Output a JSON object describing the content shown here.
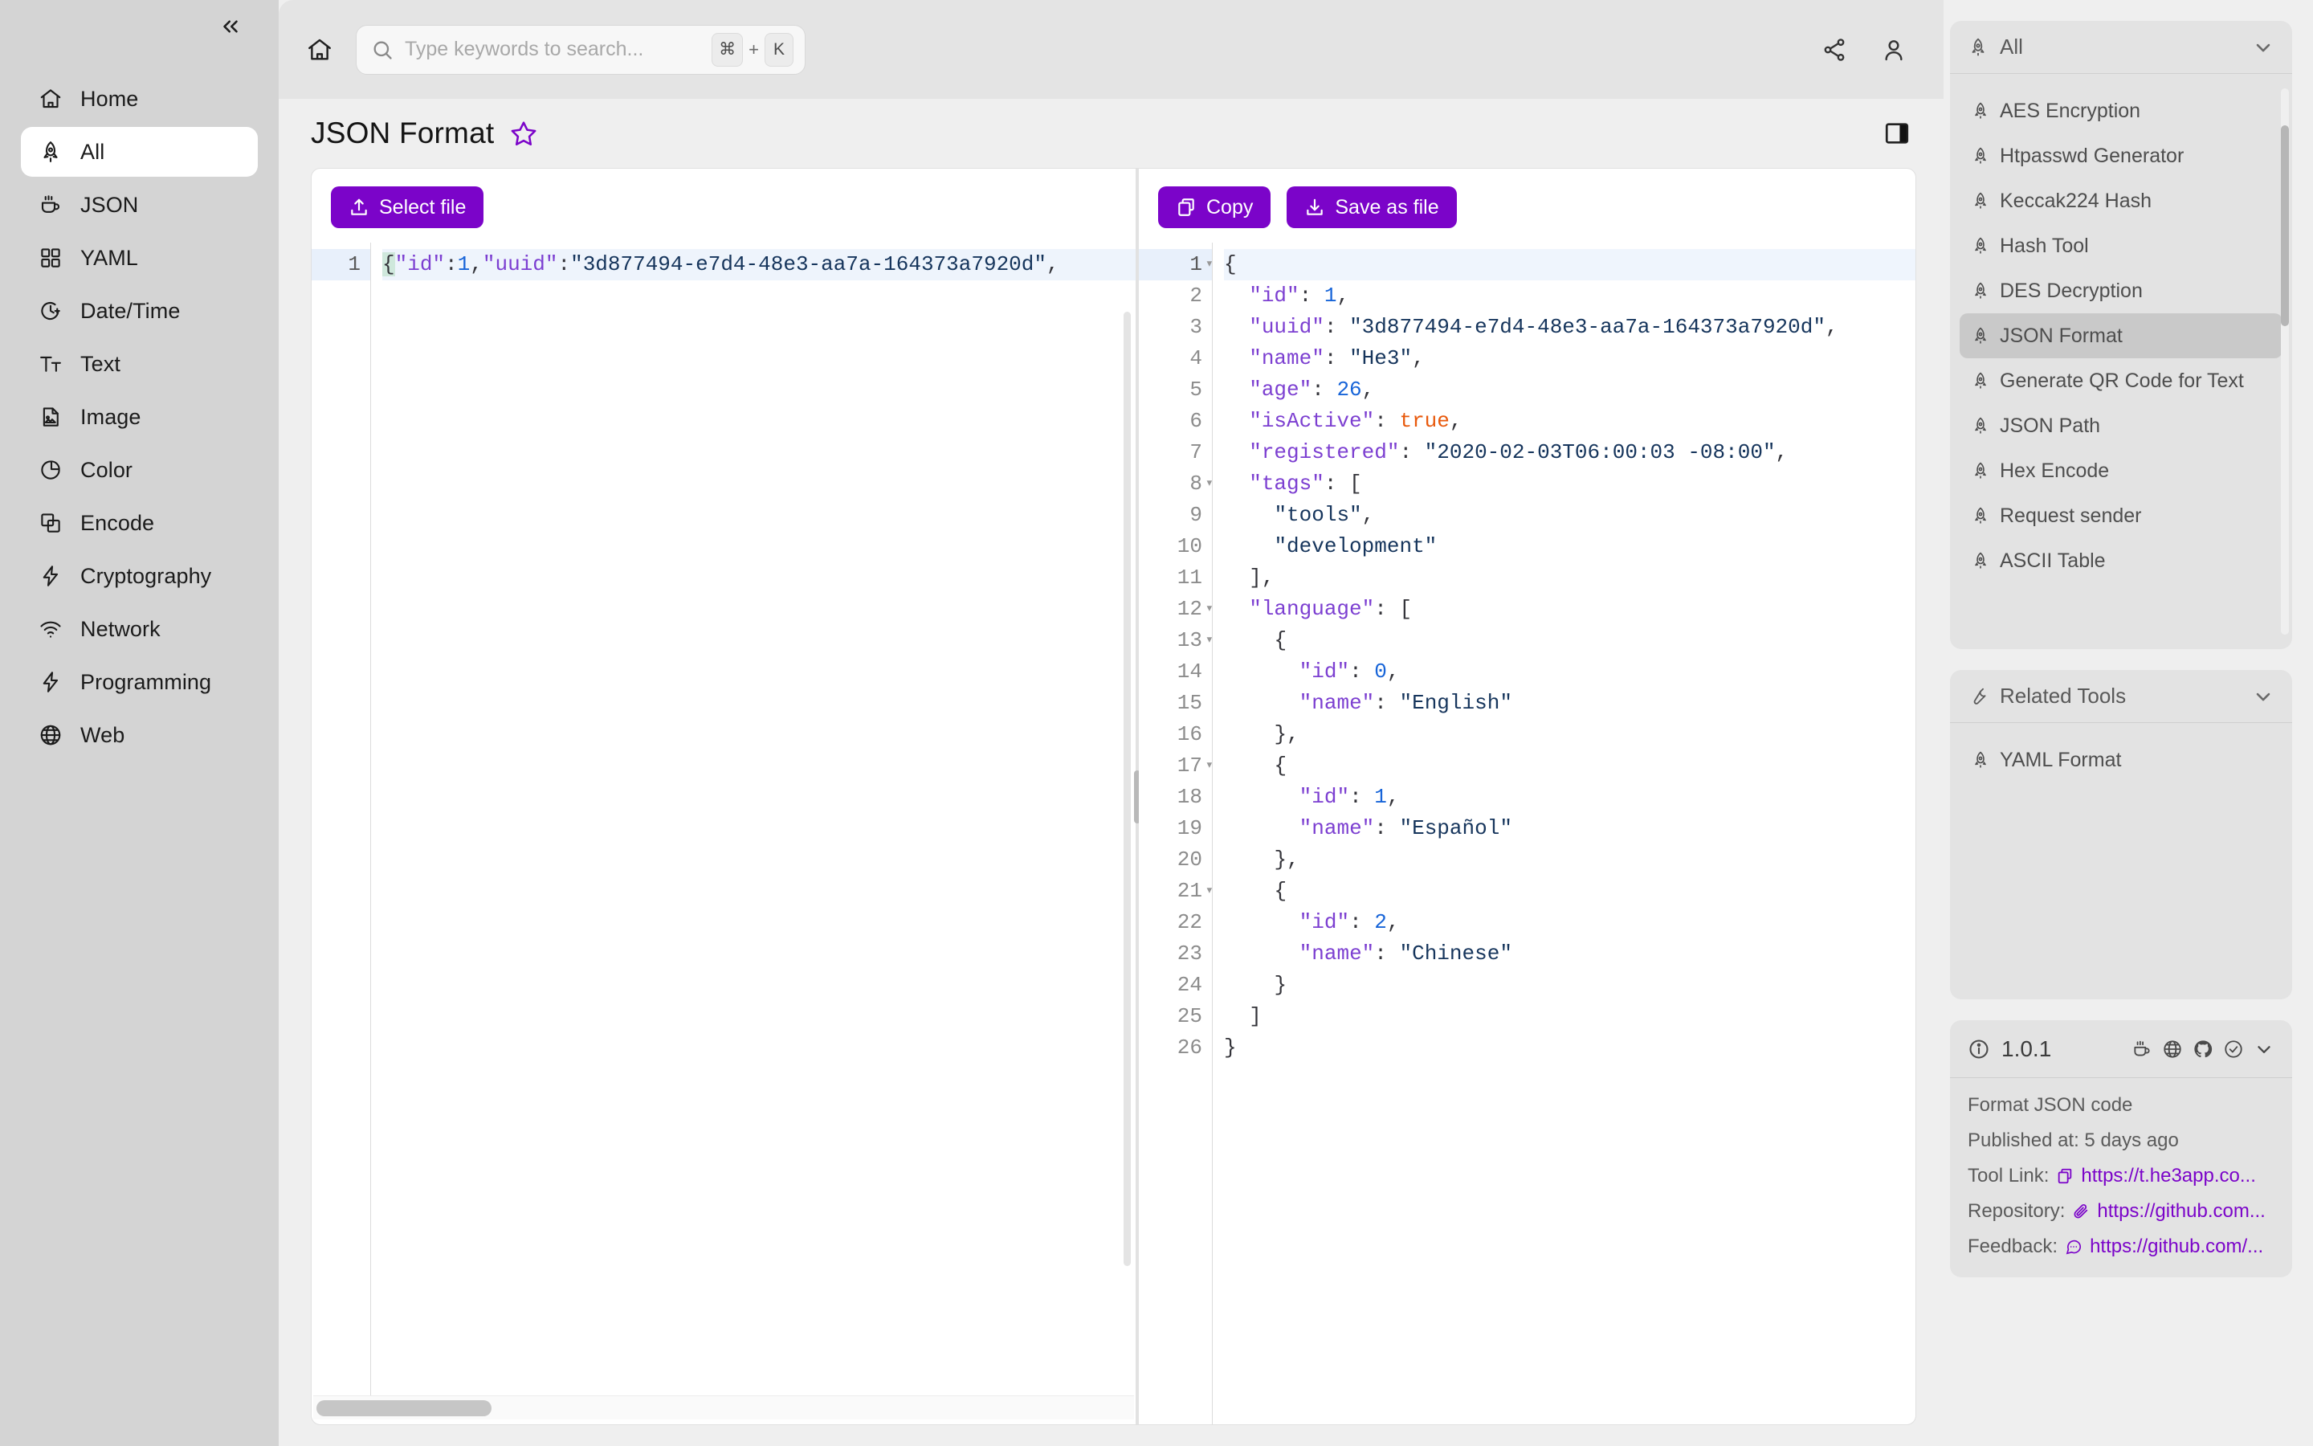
{
  "sidebar": {
    "collapse_icon": "chevrons-left-icon",
    "items": [
      {
        "label": "Home",
        "icon": "home-icon",
        "active": false
      },
      {
        "label": "All",
        "icon": "rocket-icon",
        "active": true
      },
      {
        "label": "JSON",
        "icon": "coffee-cup-icon",
        "active": false
      },
      {
        "label": "YAML",
        "icon": "grid-icon",
        "active": false
      },
      {
        "label": "Date/Time",
        "icon": "clock-icon",
        "active": false
      },
      {
        "label": "Text",
        "icon": "text-size-icon",
        "active": false
      },
      {
        "label": "Image",
        "icon": "image-file-icon",
        "active": false
      },
      {
        "label": "Color",
        "icon": "pie-chart-icon",
        "active": false
      },
      {
        "label": "Encode",
        "icon": "layers-icon",
        "active": false
      },
      {
        "label": "Cryptography",
        "icon": "bolt-icon",
        "active": false
      },
      {
        "label": "Network",
        "icon": "wifi-icon",
        "active": false
      },
      {
        "label": "Programming",
        "icon": "bolt-icon",
        "active": false
      },
      {
        "label": "Web",
        "icon": "globe-icon",
        "active": false
      }
    ]
  },
  "topbar": {
    "home_icon": "home-icon",
    "search": {
      "icon": "search-icon",
      "placeholder": "Type keywords to search...",
      "value": "",
      "shortcut_key_1": "⌘",
      "shortcut_plus": "+",
      "shortcut_key_2": "K"
    },
    "share_icon": "share-icon",
    "account_icon": "user-icon"
  },
  "page": {
    "title": "JSON Format",
    "star_icon": "star-outline-icon",
    "star_color": "#7b04c9",
    "panel_toggle_icon": "right-panel-toggle-icon"
  },
  "input_pane": {
    "select_file_label": "Select file",
    "select_file_icon": "upload-icon",
    "line_numbers": [
      "1"
    ],
    "raw_text": "{\"id\":1,\"uuid\":\"3d877494-e7d4-48e3-aa7a-164373a7920d\","
  },
  "output_pane": {
    "copy_label": "Copy",
    "copy_icon": "copy-icon",
    "save_label": "Save as file",
    "save_icon": "download-icon",
    "lines": [
      {
        "no": "1",
        "fold": true,
        "text": "{"
      },
      {
        "no": "2",
        "fold": false,
        "text": "  \"id\": 1,"
      },
      {
        "no": "3",
        "fold": false,
        "text": "  \"uuid\": \"3d877494-e7d4-48e3-aa7a-164373a7920d\","
      },
      {
        "no": "4",
        "fold": false,
        "text": "  \"name\": \"He3\","
      },
      {
        "no": "5",
        "fold": false,
        "text": "  \"age\": 26,"
      },
      {
        "no": "6",
        "fold": false,
        "text": "  \"isActive\": true,"
      },
      {
        "no": "7",
        "fold": false,
        "text": "  \"registered\": \"2020-02-03T06:00:03 -08:00\","
      },
      {
        "no": "8",
        "fold": true,
        "text": "  \"tags\": ["
      },
      {
        "no": "9",
        "fold": false,
        "text": "    \"tools\","
      },
      {
        "no": "10",
        "fold": false,
        "text": "    \"development\""
      },
      {
        "no": "11",
        "fold": false,
        "text": "  ],"
      },
      {
        "no": "12",
        "fold": true,
        "text": "  \"language\": ["
      },
      {
        "no": "13",
        "fold": true,
        "text": "    {"
      },
      {
        "no": "14",
        "fold": false,
        "text": "      \"id\": 0,"
      },
      {
        "no": "15",
        "fold": false,
        "text": "      \"name\": \"English\""
      },
      {
        "no": "16",
        "fold": false,
        "text": "    },"
      },
      {
        "no": "17",
        "fold": true,
        "text": "    {"
      },
      {
        "no": "18",
        "fold": false,
        "text": "      \"id\": 1,"
      },
      {
        "no": "19",
        "fold": false,
        "text": "      \"name\": \"Español\""
      },
      {
        "no": "20",
        "fold": false,
        "text": "    },"
      },
      {
        "no": "21",
        "fold": true,
        "text": "    {"
      },
      {
        "no": "22",
        "fold": false,
        "text": "      \"id\": 2,"
      },
      {
        "no": "23",
        "fold": false,
        "text": "      \"name\": \"Chinese\""
      },
      {
        "no": "24",
        "fold": false,
        "text": "    }"
      },
      {
        "no": "25",
        "fold": false,
        "text": "  ]"
      },
      {
        "no": "26",
        "fold": false,
        "text": "}"
      }
    ]
  },
  "rightbar": {
    "tools_card": {
      "icon": "rocket-icon",
      "title": "All",
      "chevron_icon": "chevron-down-icon",
      "items": [
        {
          "label": "AES Encryption",
          "active": false
        },
        {
          "label": "Htpasswd Generator",
          "active": false
        },
        {
          "label": "Keccak224 Hash",
          "active": false
        },
        {
          "label": "Hash Tool",
          "active": false
        },
        {
          "label": "DES Decryption",
          "active": false
        },
        {
          "label": "JSON Format",
          "active": true
        },
        {
          "label": "Generate QR Code for Text",
          "active": false
        },
        {
          "label": "JSON Path",
          "active": false
        },
        {
          "label": "Hex Encode",
          "active": false
        },
        {
          "label": "Request sender",
          "active": false
        },
        {
          "label": "ASCII Table",
          "active": false
        }
      ]
    },
    "related_card": {
      "icon": "wrench-icon",
      "title": "Related Tools",
      "chevron_icon": "chevron-down-icon",
      "items": [
        {
          "label": "YAML Format"
        }
      ]
    },
    "version_card": {
      "info_icon": "info-circle-icon",
      "version": "1.0.1",
      "icons": [
        "coffee-cup-icon",
        "globe-icon",
        "github-icon",
        "check-circle-icon",
        "chevron-down-icon"
      ],
      "description": "Format JSON code",
      "published_label": "Published at: 5 days ago",
      "tool_link_label": "Tool Link:",
      "tool_link_icon": "copy-icon",
      "tool_link_value": "https://t.he3app.co...",
      "repository_label": "Repository:",
      "repository_icon": "paperclip-icon",
      "repository_value": "https://github.com...",
      "feedback_label": "Feedback:",
      "feedback_icon": "message-circle-icon",
      "feedback_value": "https://github.com/...",
      "link_color": "#7b04c9"
    }
  }
}
